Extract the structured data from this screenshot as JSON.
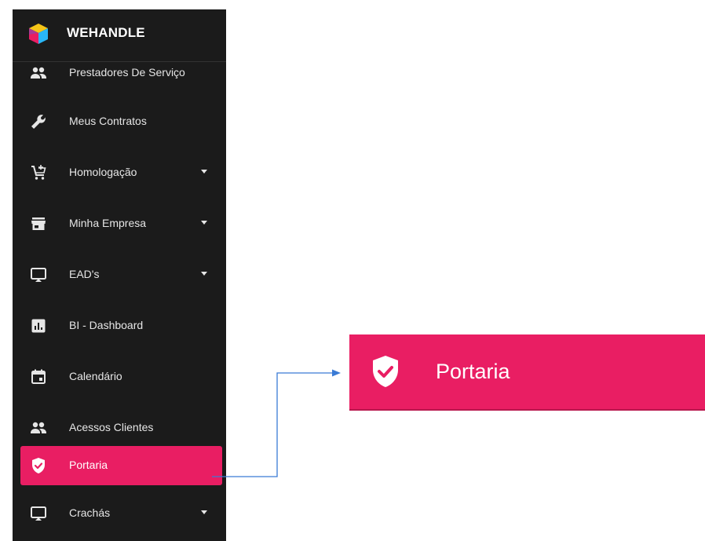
{
  "app": {
    "brand_name": "WEHANDLE",
    "logo_icon": "cube-logo-icon"
  },
  "sidebar": {
    "items": [
      {
        "label": "Prestadores De Serviço",
        "icon": "people-icon",
        "has_submenu": false
      },
      {
        "label": "Meus Contratos",
        "icon": "wrench-icon",
        "has_submenu": false
      },
      {
        "label": "Homologação",
        "icon": "cart-icon",
        "has_submenu": true
      },
      {
        "label": "Minha Empresa",
        "icon": "store-icon",
        "has_submenu": true
      },
      {
        "label": "EAD's",
        "icon": "monitor-icon",
        "has_submenu": true
      },
      {
        "label": "BI - Dashboard",
        "icon": "chart-icon",
        "has_submenu": false
      },
      {
        "label": "Calendário",
        "icon": "calendar-icon",
        "has_submenu": false
      },
      {
        "label": "Acessos Clientes",
        "icon": "people-icon",
        "has_submenu": false
      },
      {
        "label": "Portaria",
        "icon": "shield-check-icon",
        "has_submenu": false,
        "active": true
      },
      {
        "label": "Crachás",
        "icon": "monitor-icon",
        "has_submenu": true
      }
    ]
  },
  "callout": {
    "label": "Portaria",
    "icon": "shield-check-icon"
  },
  "colors": {
    "sidebar_bg": "#1b1b1b",
    "accent": "#e91e63",
    "text": "#e6e6e6",
    "arrow": "#3a7bd5"
  }
}
